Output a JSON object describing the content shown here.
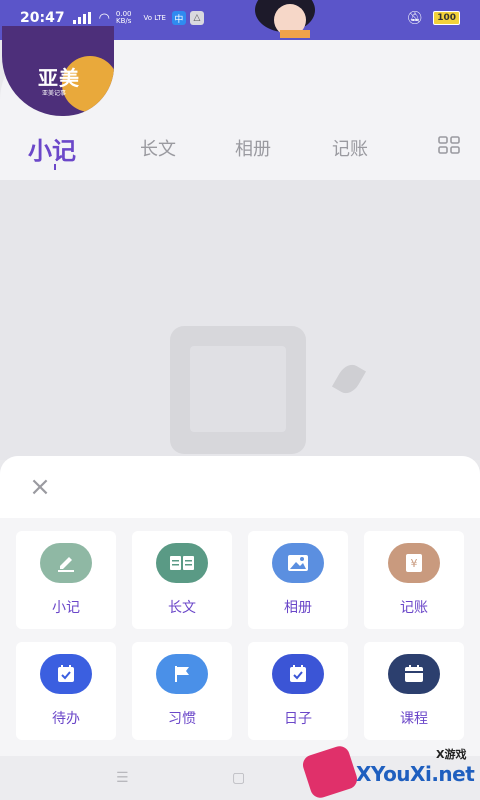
{
  "status_bar": {
    "time": "20:47",
    "net_speed_top": "0.00",
    "net_speed_unit": "KB/s",
    "net_type": "Vo LTE",
    "battery": "100"
  },
  "logo": {
    "text": "亚美",
    "subtext": "亚美记事"
  },
  "tabs": [
    {
      "label": "小记",
      "active": true
    },
    {
      "label": "长文",
      "active": false
    },
    {
      "label": "相册",
      "active": false
    },
    {
      "label": "记账",
      "active": false
    }
  ],
  "sheet": {
    "close_symbol": "×",
    "items": [
      {
        "label": "小记",
        "icon": "pen-icon",
        "color": "#8fb8a4"
      },
      {
        "label": "长文",
        "icon": "book-icon",
        "color": "#5a9a85"
      },
      {
        "label": "相册",
        "icon": "image-icon",
        "color": "#5b8fe0"
      },
      {
        "label": "记账",
        "icon": "yen-icon",
        "color": "#c99a7e"
      },
      {
        "label": "待办",
        "icon": "calendar-check-icon",
        "color": "#3b5fe0"
      },
      {
        "label": "习惯",
        "icon": "flag-icon",
        "color": "#4a90e8"
      },
      {
        "label": "日子",
        "icon": "calendar-check-icon",
        "color": "#3b55d6"
      },
      {
        "label": "课程",
        "icon": "calendar-icon",
        "color": "#2c3f6e"
      }
    ]
  },
  "watermark": {
    "brand": "XYouXi.net",
    "small": "X游戏"
  },
  "colors": {
    "accent": "#6b47c9",
    "banner": "#5b55c9"
  }
}
